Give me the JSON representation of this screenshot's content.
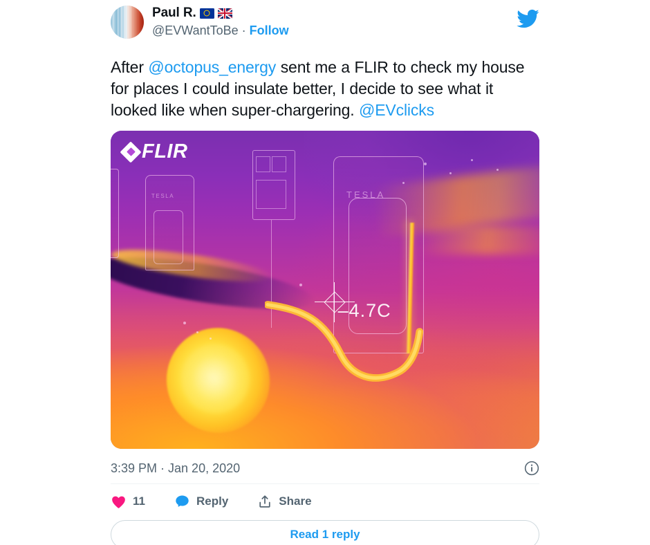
{
  "tweet": {
    "author": {
      "display_name": "Paul R.",
      "flags": [
        "flag-eu",
        "flag-uk"
      ],
      "handle": "@EVWantToBe",
      "separator": "·",
      "follow_label": "Follow",
      "avatar_name": "warming-stripes-avatar"
    },
    "brand_icon": "twitter-bird-icon",
    "text": {
      "part1": "After ",
      "mention1": "@octopus_energy",
      "part2": " sent me a FLIR to check my house for places I could insulate better, I decide to see what it looked like when super-chargering. ",
      "mention2": "@EVclicks"
    },
    "media": {
      "type": "thermal-image",
      "brand": "FLIR",
      "temperature_reading": "–4.7C",
      "crosshair_label": "spot-temperature-marker",
      "subject_labels": [
        "TESLA",
        "TESLA"
      ],
      "alt_summary": "FLIR thermal image of a Tesla Supercharger with a hot charging cable and a glowing hot car wheel"
    },
    "timestamp": "3:39 PM · Jan 20, 2020",
    "info_icon": "info-circle-icon",
    "actions": {
      "like": {
        "icon": "heart-icon",
        "count": "11",
        "color": "#f91880"
      },
      "reply": {
        "icon": "speech-bubble-icon",
        "label": "Reply",
        "color": "#1d9bf0"
      },
      "share": {
        "icon": "share-upload-icon",
        "label": "Share",
        "color": "#536471"
      }
    },
    "read_replies_label": "Read 1 reply"
  },
  "colors": {
    "twitter_blue": "#1d9bf0",
    "like_pink": "#f91880",
    "text_primary": "#0f1419",
    "text_secondary": "#536471",
    "divider": "#eff3f4",
    "border": "#cfd9de"
  }
}
